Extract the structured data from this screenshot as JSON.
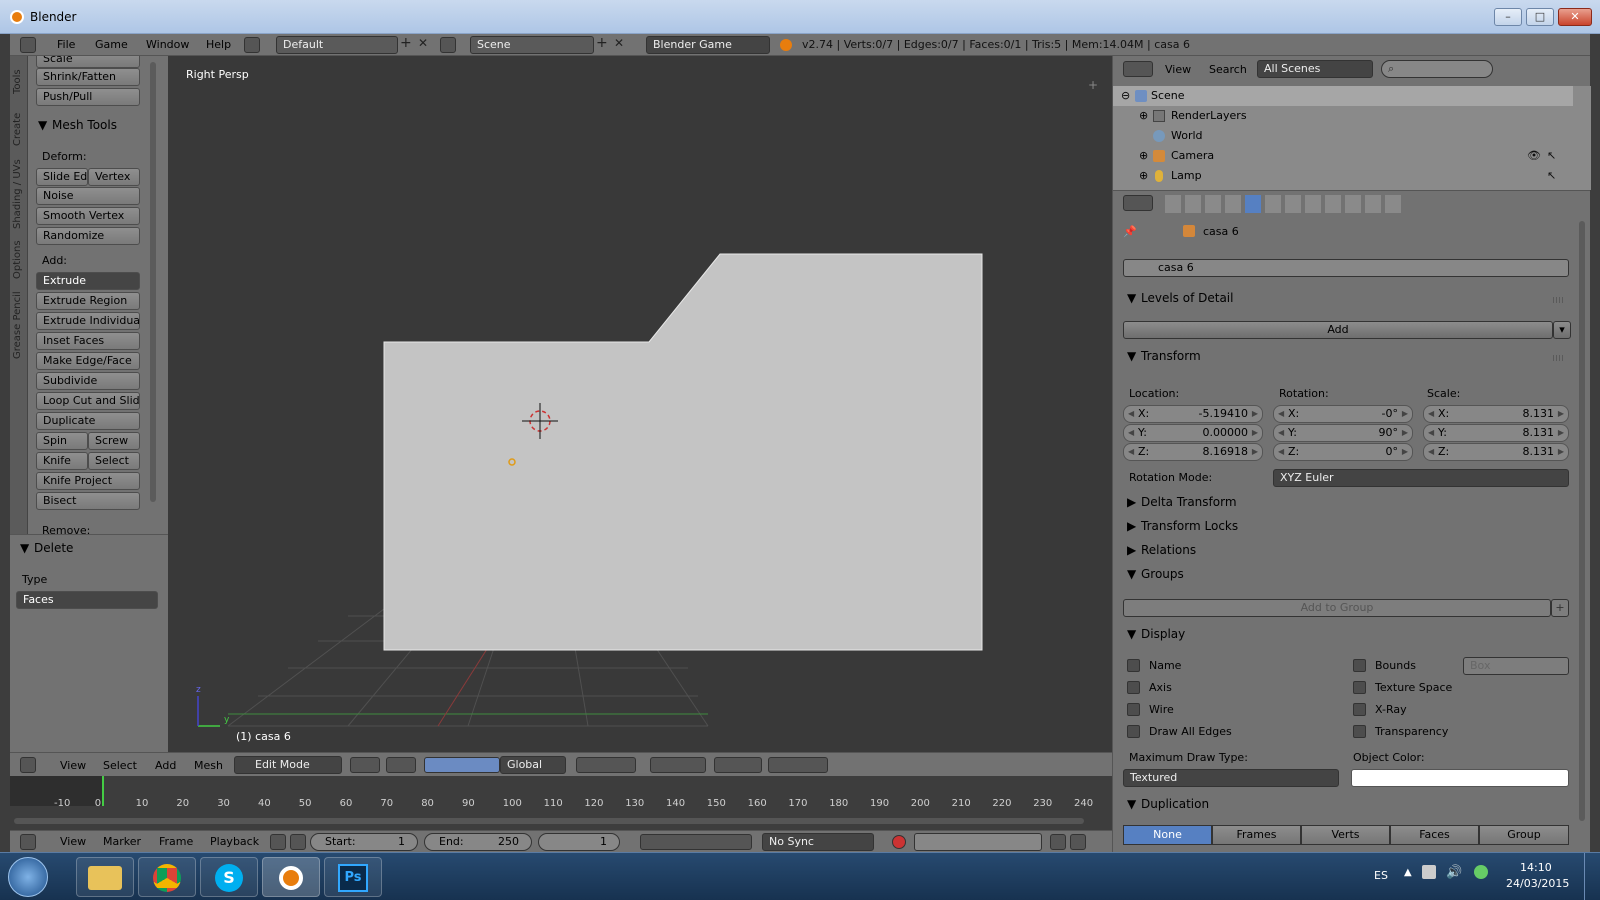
{
  "window": {
    "title": "Blender"
  },
  "info_header": {
    "menus": [
      "File",
      "Game",
      "Window",
      "Help"
    ],
    "screen_layout": "Default",
    "scene": "Scene",
    "engine": "Blender Game",
    "stats": "v2.74 | Verts:0/7 | Edges:0/7 | Faces:0/1 | Tris:5 | Mem:14.04M | casa 6"
  },
  "tool_tabs": [
    "Tools",
    "Create",
    "Shading / UVs",
    "Options",
    "Grease Pencil"
  ],
  "tool_shelf": {
    "top_buttons": [
      "Scale",
      "Shrink/Fatten",
      "Push/Pull"
    ],
    "mesh_tools_title": "Mesh Tools",
    "deform_label": "Deform:",
    "deform_pair": [
      "Slide Ed",
      "Vertex"
    ],
    "deform_buttons": [
      "Noise",
      "Smooth Vertex",
      "Randomize"
    ],
    "add_label": "Add:",
    "extrude_menu": "Extrude",
    "add_buttons": [
      "Extrude Region",
      "Extrude Individual",
      "Inset Faces",
      "Make Edge/Face",
      "Subdivide",
      "Loop Cut and Slide",
      "Duplicate"
    ],
    "spin_pair": [
      "Spin",
      "Screw"
    ],
    "knife_pair": [
      "Knife",
      "Select"
    ],
    "more_buttons": [
      "Knife Project",
      "Bisect"
    ],
    "remove_label": "Remove:"
  },
  "operator_panel": {
    "title": "Delete",
    "type_label": "Type",
    "type_value": "Faces"
  },
  "viewport": {
    "view_name": "Right Persp",
    "object_label": "(1) casa 6"
  },
  "view3d_header": {
    "menus": [
      "View",
      "Select",
      "Add",
      "Mesh"
    ],
    "mode": "Edit Mode",
    "orientation": "Global"
  },
  "timeline": {
    "ticks": [
      "-10",
      "0",
      "10",
      "20",
      "30",
      "40",
      "50",
      "60",
      "70",
      "80",
      "90",
      "100",
      "110",
      "120",
      "130",
      "140",
      "150",
      "160",
      "170",
      "180",
      "190",
      "200",
      "210",
      "220",
      "230",
      "240"
    ],
    "current_frame": 1
  },
  "timeline_header": {
    "menus": [
      "View",
      "Marker",
      "Frame",
      "Playback"
    ],
    "start": "Start:",
    "start_value": "1",
    "end": "End:",
    "end_value": "250",
    "frame_value": "1",
    "sync": "No Sync"
  },
  "outliner": {
    "menus": [
      "View",
      "Search"
    ],
    "filter": "All Scenes",
    "rows": [
      "Scene",
      "RenderLayers",
      "World",
      "Camera",
      "Lamp"
    ]
  },
  "properties": {
    "object_name": "casa 6",
    "lod_title": "Levels of Detail",
    "add_button": "Add",
    "transform_title": "Transform",
    "location_label": "Location:",
    "rotation_label": "Rotation:",
    "scale_label": "Scale:",
    "location": {
      "x": "-5.19410",
      "y": "0.00000",
      "z": "8.16918"
    },
    "rotation": {
      "x": "-0°",
      "y": "90°",
      "z": "0°"
    },
    "scale": {
      "x": "8.131",
      "y": "8.131",
      "z": "8.131"
    },
    "axis_labels": {
      "x": "X:",
      "y": "Y:",
      "z": "Z:"
    },
    "rotation_mode_label": "Rotation Mode:",
    "rotation_mode": "XYZ Euler",
    "delta_transform": "Delta Transform",
    "transform_locks": "Transform Locks",
    "relations": "Relations",
    "groups": "Groups",
    "add_to_group": "Add to Group",
    "display": "Display",
    "display_left": [
      "Name",
      "Axis",
      "Wire",
      "Draw All Edges"
    ],
    "display_right": [
      "Bounds",
      "Texture Space",
      "X-Ray",
      "Transparency"
    ],
    "bounds_type": "Box",
    "max_draw_type_label": "Maximum Draw Type:",
    "max_draw_type": "Textured",
    "object_color_label": "Object Color:",
    "duplication": "Duplication",
    "dup_tabs": [
      "None",
      "Frames",
      "Verts",
      "Faces",
      "Group"
    ]
  },
  "taskbar": {
    "lang": "ES",
    "time": "14:10",
    "date": "24/03/2015"
  },
  "colors": {
    "accent": "#5680c2",
    "panel": "#727272",
    "viewport": "#393939"
  }
}
